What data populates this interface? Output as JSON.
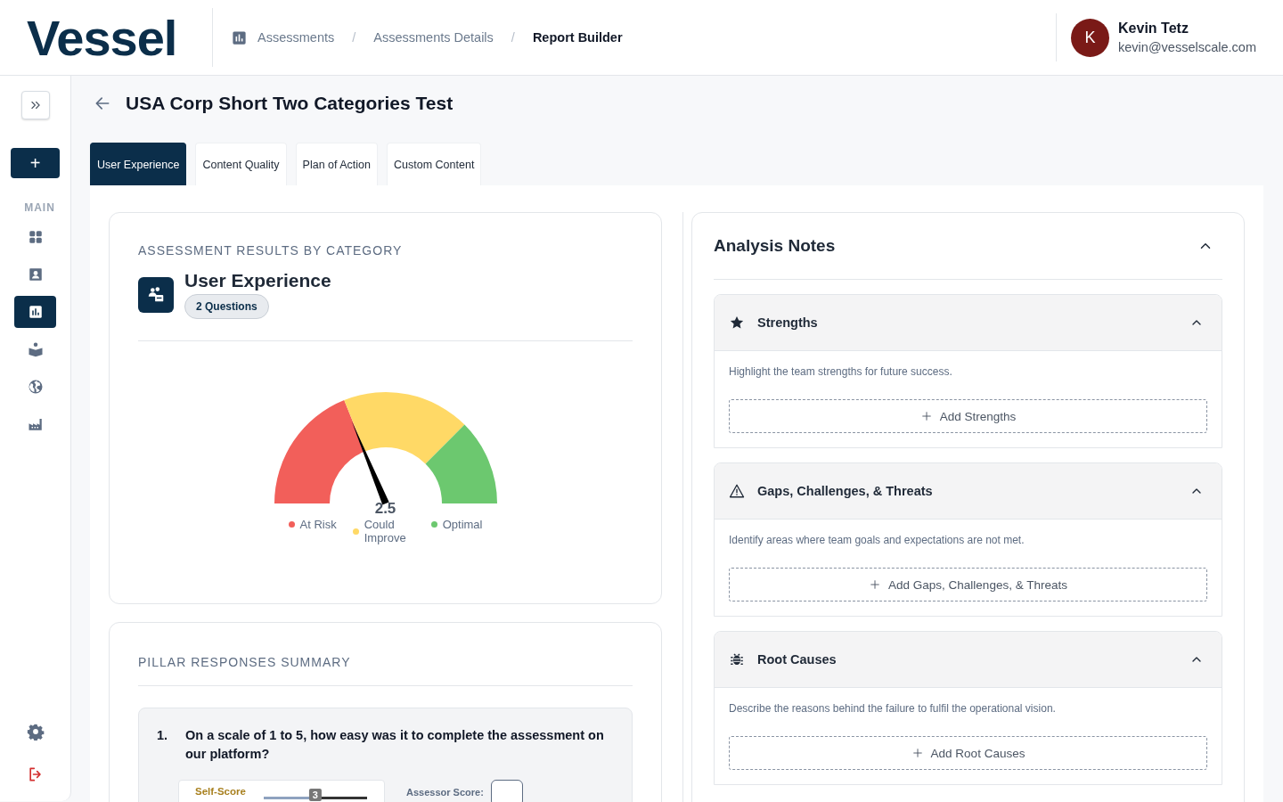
{
  "header": {
    "logo": "Vessel",
    "separator": "/",
    "breadcrumbs": [
      {
        "label": "Assessments",
        "current": false
      },
      {
        "label": "Assessments Details",
        "current": false
      },
      {
        "label": "Report Builder",
        "current": true
      }
    ],
    "user": {
      "initial": "K",
      "name": "Kevin Tetz",
      "email": "kevin@vesselscale.com"
    }
  },
  "sidebar": {
    "add": "+",
    "section_label": "MAIN",
    "items": [
      {
        "kind": "grid",
        "selected": false
      },
      {
        "kind": "contact",
        "selected": false
      },
      {
        "kind": "chart",
        "selected": true
      },
      {
        "kind": "reader",
        "selected": false
      },
      {
        "kind": "globe",
        "selected": false
      },
      {
        "kind": "factory",
        "selected": false
      }
    ],
    "bottom": [
      {
        "kind": "settings"
      },
      {
        "kind": "logout"
      }
    ]
  },
  "page": {
    "title": "USA Corp Short Two Categories Test"
  },
  "tabs": [
    {
      "label": "User Experience",
      "selected": true
    },
    {
      "label": "Content Quality",
      "selected": false
    },
    {
      "label": "Plan of Action",
      "selected": false
    },
    {
      "label": "Custom Content",
      "selected": false
    }
  ],
  "results": {
    "heading": "ASSESSMENT RESULTS BY CATEGORY",
    "category": "User Experience",
    "badge": "2 Questions",
    "gauge": {
      "level": 0.375,
      "reading": "2.5",
      "legend": [
        {
          "label": "At Risk",
          "color": "#f25f5a"
        },
        {
          "label": "Could Improve",
          "color": "#ffd966"
        },
        {
          "label": "Optimal",
          "color": "#6cc86f"
        }
      ]
    }
  },
  "summary": {
    "heading": "PILLAR RESPONSES SUMMARY",
    "questions": [
      {
        "number": "1.",
        "text": "On a scale of 1 to 5, how easy was it to complete the assessment on our platform?",
        "self_score_label": "Self-Score",
        "self_score": "3",
        "level": 0.5,
        "assessor_label": "Assessor Score:"
      }
    ]
  },
  "notes": {
    "title": "Analysis Notes",
    "expanded": true,
    "sections": [
      {
        "kind": "star",
        "title": "Strengths",
        "expanded": true,
        "description": "Highlight the team strengths for future success.",
        "action": "Add Strengths"
      },
      {
        "kind": "warning",
        "title": "Gaps, Challenges, & Threats",
        "expanded": true,
        "description": "Identify areas where team goals and expectations are not met.",
        "action": "Add Gaps, Challenges, & Threats"
      },
      {
        "kind": "bug",
        "title": "Root Causes",
        "expanded": true,
        "description": "Describe the reasons behind the failure to fulfil the operational vision.",
        "action": "Add Root Causes"
      }
    ]
  }
}
